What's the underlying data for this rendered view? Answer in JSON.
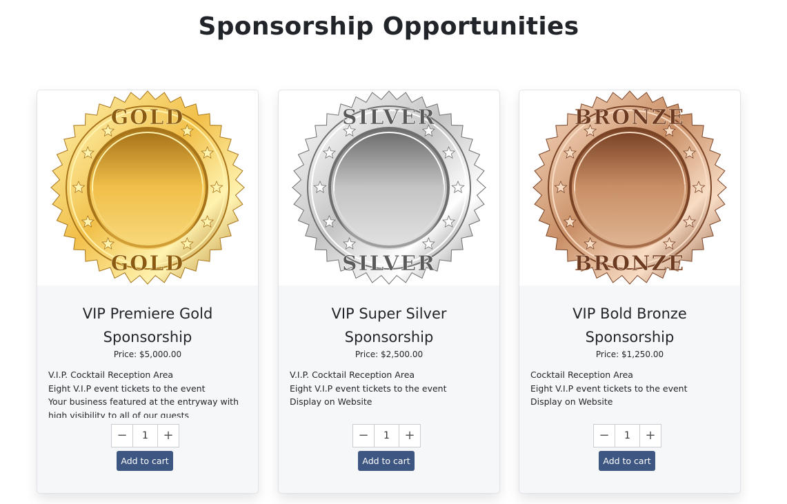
{
  "page": {
    "title": "Sponsorship Opportunities"
  },
  "cards": [
    {
      "medal_word": "GOLD",
      "medal_colors": {
        "light": "#fff3b0",
        "mid": "#f1c04a",
        "dark": "#a8741a",
        "text": "#8a5a12"
      },
      "title_line1": "VIP Premiere Gold",
      "title_line2": "Sponsorship",
      "price": "Price: $5,000.00",
      "features": [
        "V.I.P. Cocktail Reception Area",
        "Eight V.I.P event tickets to the event",
        "Your business featured at the entryway with",
        "high visibility to all of our guests"
      ],
      "quantity": "1",
      "decrement_label": "−",
      "increment_label": "+",
      "add_to_cart_label": "Add to cart"
    },
    {
      "medal_word": "SILVER",
      "medal_colors": {
        "light": "#ffffff",
        "mid": "#c4c4c4",
        "dark": "#6e6e6e",
        "text": "#5a5a5a"
      },
      "title_line1": "VIP Super Silver",
      "title_line2": "Sponsorship",
      "price": "Price: $2,500.00",
      "features": [
        "V.I.P. Cocktail Reception Area",
        "Eight V.I.P event tickets to the event",
        "Display on Website"
      ],
      "quantity": "1",
      "decrement_label": "−",
      "increment_label": "+",
      "add_to_cart_label": "Add to cart"
    },
    {
      "medal_word": "BRONZE",
      "medal_colors": {
        "light": "#f8dcc4",
        "mid": "#c98f66",
        "dark": "#7a4326",
        "text": "#6b3a20"
      },
      "title_line1": "VIP Bold Bronze",
      "title_line2": "Sponsorship",
      "price": "Price: $1,250.00",
      "features": [
        "Cocktail Reception Area",
        "Eight V.I.P event tickets to the event",
        "Display on Website"
      ],
      "quantity": "1",
      "decrement_label": "−",
      "increment_label": "+",
      "add_to_cart_label": "Add to cart"
    }
  ],
  "colors": {
    "button": "#3d5782",
    "card_background": "#f6f7f9"
  }
}
